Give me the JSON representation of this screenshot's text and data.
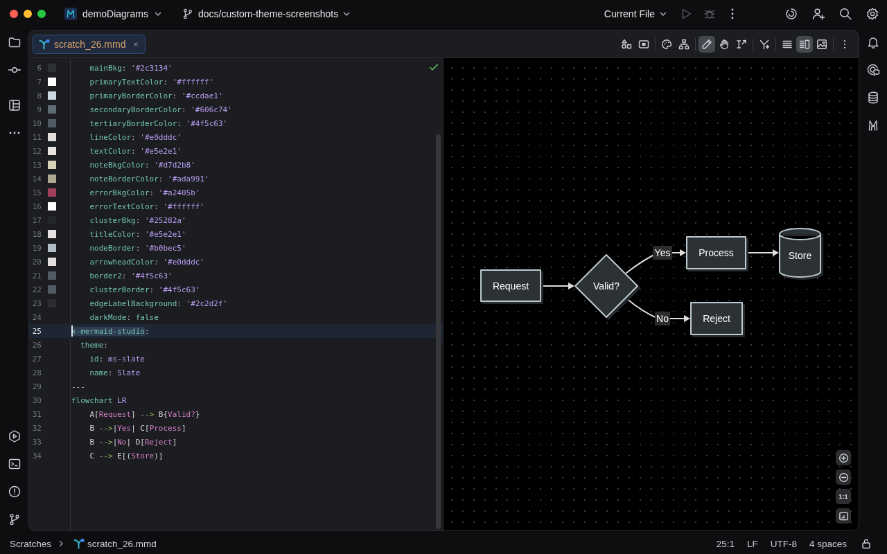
{
  "title_bar": {
    "project": "demoDiagrams",
    "branch": "docs/custom-theme-screenshots",
    "run_config": "Current File",
    "run_disabled": true,
    "debug_disabled": true
  },
  "editor_tabs": [
    {
      "label": "scratch_26.mmd",
      "selected": true
    }
  ],
  "preview_toolbar": {
    "edit_tools": [
      {
        "selected": true
      },
      {
        "selected": false
      },
      {
        "selected": false
      }
    ],
    "view_modes": [
      {
        "selected": false
      },
      {
        "selected": true
      },
      {
        "selected": false
      }
    ]
  },
  "editor": {
    "lines": [
      {
        "number": "6",
        "color": "#2c3134",
        "current": false,
        "tokens": [
          {
            "text": "    mainBkg",
            "kind": "key"
          },
          {
            "text": ": ",
            "kind": "punct"
          },
          {
            "text": "'#2c3134'",
            "kind": "string"
          }
        ]
      },
      {
        "number": "7",
        "color": "#ffffff",
        "current": false,
        "tokens": [
          {
            "text": "    primaryTextColor",
            "kind": "key"
          },
          {
            "text": ": ",
            "kind": "punct"
          },
          {
            "text": "'#ffffff'",
            "kind": "string"
          }
        ]
      },
      {
        "number": "8",
        "color": "#ccdae1",
        "current": false,
        "tokens": [
          {
            "text": "    primaryBorderColor",
            "kind": "key"
          },
          {
            "text": ": ",
            "kind": "punct"
          },
          {
            "text": "'#ccdae1'",
            "kind": "string"
          }
        ]
      },
      {
        "number": "9",
        "color": "#606c74",
        "current": false,
        "tokens": [
          {
            "text": "    secondaryBorderColor",
            "kind": "key"
          },
          {
            "text": ": ",
            "kind": "punct"
          },
          {
            "text": "'#606c74'",
            "kind": "string"
          }
        ]
      },
      {
        "number": "10",
        "color": "#4f5c63",
        "current": false,
        "tokens": [
          {
            "text": "    tertiaryBorderColor",
            "kind": "key"
          },
          {
            "text": ": ",
            "kind": "punct"
          },
          {
            "text": "'#4f5c63'",
            "kind": "string"
          }
        ]
      },
      {
        "number": "11",
        "color": "#e0dddc",
        "current": false,
        "tokens": [
          {
            "text": "    lineColor",
            "kind": "key"
          },
          {
            "text": ": ",
            "kind": "punct"
          },
          {
            "text": "'#e0dddc'",
            "kind": "string"
          }
        ]
      },
      {
        "number": "12",
        "color": "#e5e2e1",
        "current": false,
        "tokens": [
          {
            "text": "    textColor",
            "kind": "key"
          },
          {
            "text": ": ",
            "kind": "punct"
          },
          {
            "text": "'#e5e2e1'",
            "kind": "string"
          }
        ]
      },
      {
        "number": "13",
        "color": "#d7d2b8",
        "current": false,
        "tokens": [
          {
            "text": "    noteBkgColor",
            "kind": "key"
          },
          {
            "text": ": ",
            "kind": "punct"
          },
          {
            "text": "'#d7d2b8'",
            "kind": "string"
          }
        ]
      },
      {
        "number": "14",
        "color": "#ada991",
        "current": false,
        "tokens": [
          {
            "text": "    noteBorderColor",
            "kind": "key"
          },
          {
            "text": ": ",
            "kind": "punct"
          },
          {
            "text": "'#ada991'",
            "kind": "string"
          }
        ]
      },
      {
        "number": "15",
        "color": "#a2405b",
        "current": false,
        "tokens": [
          {
            "text": "    errorBkgColor",
            "kind": "key"
          },
          {
            "text": ": ",
            "kind": "punct"
          },
          {
            "text": "'#a2405b'",
            "kind": "string"
          }
        ]
      },
      {
        "number": "16",
        "color": "#ffffff",
        "current": false,
        "tokens": [
          {
            "text": "    errorTextColor",
            "kind": "key"
          },
          {
            "text": ": ",
            "kind": "punct"
          },
          {
            "text": "'#ffffff'",
            "kind": "string"
          }
        ]
      },
      {
        "number": "17",
        "color": "#25282a",
        "current": false,
        "tokens": [
          {
            "text": "    clusterBkg",
            "kind": "key"
          },
          {
            "text": ": ",
            "kind": "punct"
          },
          {
            "text": "'#25282a'",
            "kind": "string"
          }
        ]
      },
      {
        "number": "18",
        "color": "#e5e2e1",
        "current": false,
        "tokens": [
          {
            "text": "    titleColor",
            "kind": "key"
          },
          {
            "text": ": ",
            "kind": "punct"
          },
          {
            "text": "'#e5e2e1'",
            "kind": "string"
          }
        ]
      },
      {
        "number": "19",
        "color": "#b0bec5",
        "current": false,
        "tokens": [
          {
            "text": "    nodeBorder",
            "kind": "key"
          },
          {
            "text": ": ",
            "kind": "punct"
          },
          {
            "text": "'#b0bec5'",
            "kind": "string"
          }
        ]
      },
      {
        "number": "20",
        "color": "#e0dddc",
        "current": false,
        "tokens": [
          {
            "text": "    arrowheadColor",
            "kind": "key"
          },
          {
            "text": ": ",
            "kind": "punct"
          },
          {
            "text": "'#e0dddc'",
            "kind": "string"
          }
        ]
      },
      {
        "number": "21",
        "color": "#4f5c63",
        "current": false,
        "tokens": [
          {
            "text": "    border2",
            "kind": "key"
          },
          {
            "text": ": ",
            "kind": "punct"
          },
          {
            "text": "'#4f5c63'",
            "kind": "string"
          }
        ]
      },
      {
        "number": "22",
        "color": "#4f5c63",
        "current": false,
        "tokens": [
          {
            "text": "    clusterBorder",
            "kind": "key"
          },
          {
            "text": ": ",
            "kind": "punct"
          },
          {
            "text": "'#4f5c63'",
            "kind": "string"
          }
        ]
      },
      {
        "number": "23",
        "color": "#2c2d2f",
        "current": false,
        "tokens": [
          {
            "text": "    edgeLabelBackground",
            "kind": "key"
          },
          {
            "text": ": ",
            "kind": "punct"
          },
          {
            "text": "'#2c2d2f'",
            "kind": "string"
          }
        ]
      },
      {
        "number": "24",
        "current": false,
        "tokens": [
          {
            "text": "    darkMode",
            "kind": "key"
          },
          {
            "text": ": ",
            "kind": "punct"
          },
          {
            "text": "false",
            "kind": "keyword"
          }
        ]
      },
      {
        "number": "25",
        "current": true,
        "tokens": [
          {
            "text": "x-mermaid-studio",
            "kind": "selection"
          },
          {
            "text": ":",
            "kind": "punct"
          }
        ]
      },
      {
        "number": "26",
        "current": false,
        "tokens": [
          {
            "text": "  theme",
            "kind": "key"
          },
          {
            "text": ":",
            "kind": "punct"
          }
        ]
      },
      {
        "number": "27",
        "current": false,
        "tokens": [
          {
            "text": "    id",
            "kind": "key"
          },
          {
            "text": ": ",
            "kind": "punct"
          },
          {
            "text": "ms-slate",
            "kind": "value"
          }
        ]
      },
      {
        "number": "28",
        "current": false,
        "tokens": [
          {
            "text": "    name",
            "kind": "key"
          },
          {
            "text": ": ",
            "kind": "punct"
          },
          {
            "text": "Slate",
            "kind": "value"
          }
        ]
      },
      {
        "number": "29",
        "current": false,
        "tokens": [
          {
            "text": "---",
            "kind": "punct"
          }
        ]
      },
      {
        "number": "30",
        "current": false,
        "tokens": [
          {
            "text": "flowchart",
            "kind": "keyword"
          },
          {
            "text": " LR",
            "kind": "value"
          }
        ]
      },
      {
        "number": "31",
        "current": false,
        "tokens": [
          {
            "text": "    A[",
            "kind": "plain"
          },
          {
            "text": "Request",
            "kind": "label"
          },
          {
            "text": "] ",
            "kind": "plain"
          },
          {
            "text": "-->",
            "kind": "arrow"
          },
          {
            "text": " B{",
            "kind": "plain"
          },
          {
            "text": "Valid?",
            "kind": "label"
          },
          {
            "text": "}",
            "kind": "plain"
          }
        ]
      },
      {
        "number": "32",
        "current": false,
        "tokens": [
          {
            "text": "    B ",
            "kind": "plain"
          },
          {
            "text": "-->",
            "kind": "arrow"
          },
          {
            "text": "|",
            "kind": "plain"
          },
          {
            "text": "Yes",
            "kind": "label"
          },
          {
            "text": "| C[",
            "kind": "plain"
          },
          {
            "text": "Process",
            "kind": "label"
          },
          {
            "text": "]",
            "kind": "plain"
          }
        ]
      },
      {
        "number": "33",
        "current": false,
        "tokens": [
          {
            "text": "    B ",
            "kind": "plain"
          },
          {
            "text": "-->",
            "kind": "arrow"
          },
          {
            "text": "|",
            "kind": "plain"
          },
          {
            "text": "No",
            "kind": "label"
          },
          {
            "text": "| D[",
            "kind": "plain"
          },
          {
            "text": "Reject",
            "kind": "label"
          },
          {
            "text": "]",
            "kind": "plain"
          }
        ]
      },
      {
        "number": "34",
        "current": false,
        "tokens": [
          {
            "text": "    C ",
            "kind": "plain"
          },
          {
            "text": "-->",
            "kind": "arrow"
          },
          {
            "text": " E[(",
            "kind": "plain"
          },
          {
            "text": "Store",
            "kind": "label"
          },
          {
            "text": ")]",
            "kind": "plain"
          }
        ]
      }
    ]
  },
  "preview": {
    "nodes": [
      {
        "label": "Request",
        "kind": "rect"
      },
      {
        "label": "Valid?",
        "kind": "diamond"
      },
      {
        "label": "Process",
        "kind": "rect"
      },
      {
        "label": "Store",
        "kind": "cylinder"
      },
      {
        "label": "Reject",
        "kind": "rect"
      }
    ],
    "edge_labels": [
      "Yes",
      "No"
    ],
    "actual_size": "1:1"
  },
  "status_bar": {
    "breadcrumbs": [
      "Scratches",
      "scratch_26.mmd"
    ],
    "position": "25:1",
    "line_separator": "LF",
    "encoding": "UTF-8",
    "indent": "4 spaces"
  }
}
